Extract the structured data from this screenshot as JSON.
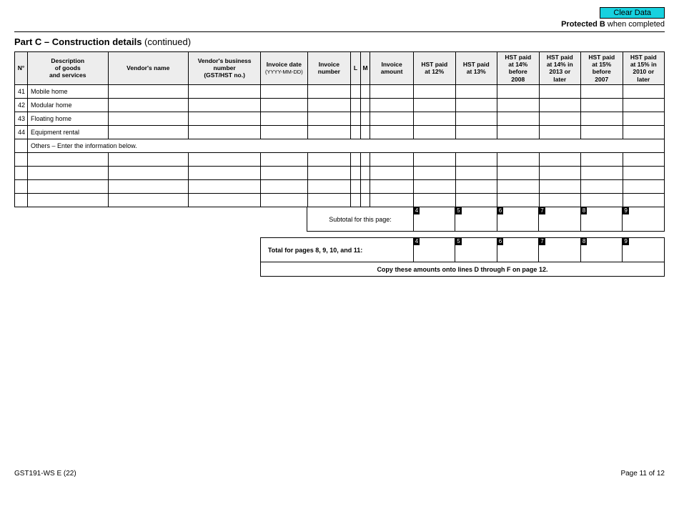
{
  "buttons": {
    "clear": "Clear Data"
  },
  "protected": {
    "bold": "Protected B",
    "suffix": " when completed"
  },
  "part": {
    "bold": "Part C – Construction details",
    "suffix": " (continued)"
  },
  "headers": {
    "n": "N°",
    "desc1": "Description",
    "desc2": "of goods",
    "desc3": "and services",
    "vendor": "Vendor's name",
    "vbn1": "Vendor's business",
    "vbn2": "number",
    "vbn3": "(GST/HST no.)",
    "date1": "Invoice date",
    "date2": "(YYYY-MM-DD)",
    "inv1": "Invoice",
    "inv2": "number",
    "l": "L",
    "m": "M",
    "amt1": "Invoice",
    "amt2": "amount",
    "h12a": "HST paid",
    "h12b": "at 12%",
    "h13a": "HST paid",
    "h13b": "at 13%",
    "h14a": "HST paid",
    "h14b": "at 14%",
    "h14c": "before",
    "h14d": "2008",
    "h14la": "HST paid",
    "h14lb": "at 14% in",
    "h14lc": "2013 or",
    "h14ld": "later",
    "h15a": "HST paid",
    "h15b": "at 15%",
    "h15c": "before",
    "h15d": "2007",
    "h15la": "HST paid",
    "h15lb": "at 15% in",
    "h15lc": "2010 or",
    "h15ld": "later"
  },
  "rows": {
    "r41n": "41",
    "r41d": "Mobile home",
    "r42n": "42",
    "r42d": "Modular home",
    "r43n": "43",
    "r43d": "Floating home",
    "r44n": "44",
    "r44d": "Equipment rental",
    "others": "Others – Enter the information below."
  },
  "subtotal": {
    "label": "Subtotal for this page:",
    "t4": "4",
    "t5": "5",
    "t6": "6",
    "t7": "7",
    "t8": "8",
    "t9": "9"
  },
  "totals": {
    "label": "Total for pages 8, 9, 10, and 11:",
    "t4": "4",
    "t5": "5",
    "t6": "6",
    "t7": "7",
    "t8": "8",
    "t9": "9",
    "copy": "Copy these amounts onto lines D through F on page 12."
  },
  "footer": {
    "form": "GST191-WS E (22)",
    "page": "Page 11 of 12"
  }
}
